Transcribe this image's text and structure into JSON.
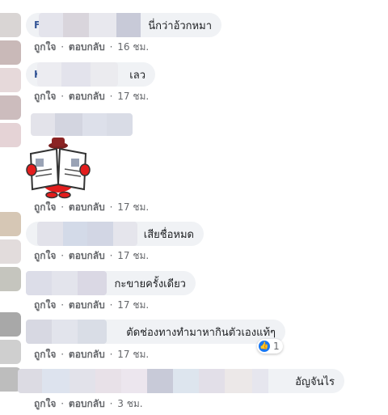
{
  "actions": {
    "like": "ถูกใจ",
    "reply": "ตอบกลับ",
    "sep": "·"
  },
  "comments": [
    {
      "name_initial": "F",
      "text": "นี่กว่าอ้วกหมา",
      "time": "16 ชม."
    },
    {
      "name_initial": "K",
      "text": "เลว",
      "time": "17 ชม."
    },
    {
      "name_initial": "",
      "text": "",
      "time": "17 ชม.",
      "sticker": "newspaper-reading-mascot"
    },
    {
      "name_initial": "",
      "text": "เสียชื่อหมด",
      "time": "17 ชม."
    },
    {
      "name_initial": "",
      "text": "กะขายครั้งเดียว",
      "time": "17 ชม."
    },
    {
      "name_initial": "",
      "text": "ตัดช่องทางทำมาหากินตัวเองแท้ๆ",
      "time": "17 ชม.",
      "reaction_count": "1"
    },
    {
      "name_initial": "",
      "text": "อัญจันไร",
      "time": "3 ชม."
    }
  ],
  "colors": {
    "link": "#385898",
    "meta": "#65676b",
    "bubble": "#f0f2f5",
    "like": "#1877f2"
  }
}
